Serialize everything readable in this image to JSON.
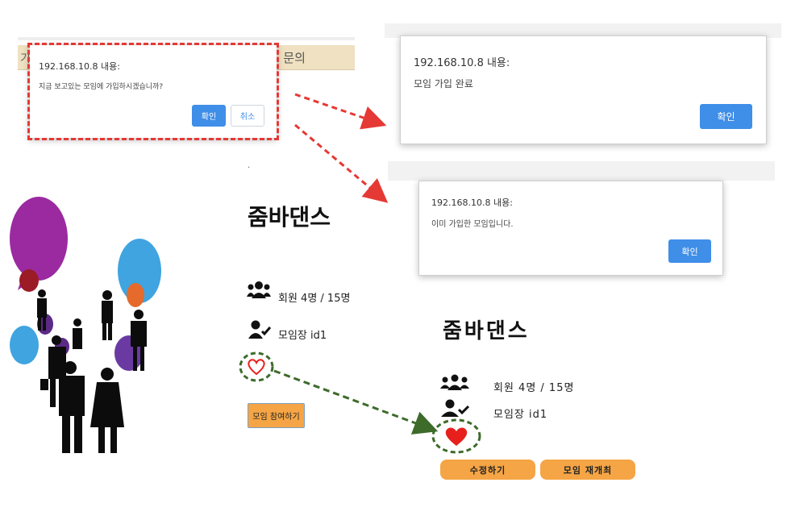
{
  "nav": {
    "left_fragment": "기",
    "right_fragment": "1 문의"
  },
  "dialog_confirm": {
    "title": "192.168.10.8 내용:",
    "message": "지금 보고있는 모임에 가입하시겠습니까?",
    "ok_label": "확인",
    "cancel_label": "취소"
  },
  "dialog_joined": {
    "title": "192.168.10.8 내용:",
    "message": "모임 가입 완료",
    "ok_label": "확인"
  },
  "dialog_already": {
    "title": "192.168.10.8 내용:",
    "message": "이미 가입한 모임입니다.",
    "ok_label": "확인"
  },
  "group_before": {
    "dot": ".",
    "title": "줌바댄스",
    "members_label": "회원 4명 / 15명",
    "leader_label": "모임장 id1",
    "join_button": "모임 참여하기"
  },
  "group_after": {
    "title": "줌바댄스",
    "members_label": "회원 4명 / 15명",
    "leader_label": "모임장 id1",
    "edit_button": "수정하기",
    "reopen_button": "모임 재개최"
  },
  "colors": {
    "dialog_button": "#3f8ee8",
    "orange_button": "#f5a545",
    "red_dash": "#e53935",
    "green_dash": "#3d6b2a",
    "heart": "#e8201d"
  },
  "icons": [
    "group-icon",
    "leader-icon",
    "heart-outline-icon",
    "heart-filled-icon"
  ]
}
